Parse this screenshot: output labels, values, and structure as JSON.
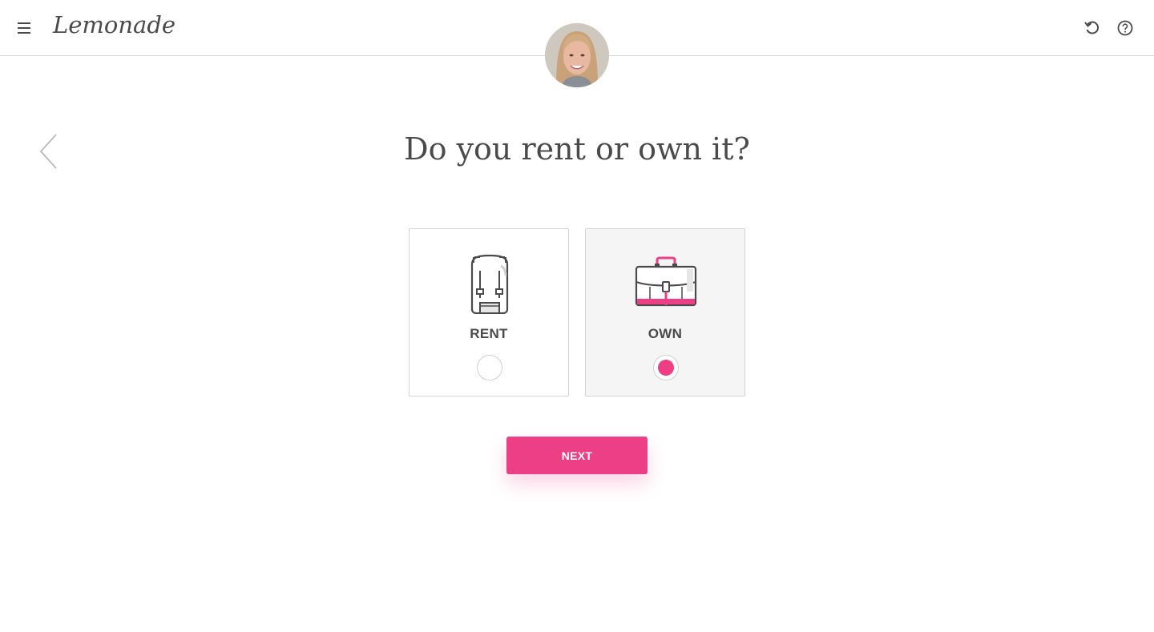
{
  "header": {
    "logo_text": "Lemonade",
    "menu_icon": "hamburger-menu-icon",
    "undo_icon": "undo-icon",
    "help_icon": "help-circle-icon"
  },
  "assistant": {
    "avatar_icon": "assistant-avatar"
  },
  "navigation": {
    "back_icon": "chevron-left-icon"
  },
  "question": {
    "text": "Do you rent or own it?"
  },
  "options": [
    {
      "label": "RENT",
      "icon": "backpack-icon",
      "selected": false
    },
    {
      "label": "OWN",
      "icon": "briefcase-icon",
      "selected": true
    }
  ],
  "actions": {
    "next_label": "NEXT"
  },
  "colors": {
    "accent": "#ec3f85",
    "text": "#4a4a4a",
    "border": "#d4d4d4",
    "selected_bg": "#f5f5f5"
  }
}
